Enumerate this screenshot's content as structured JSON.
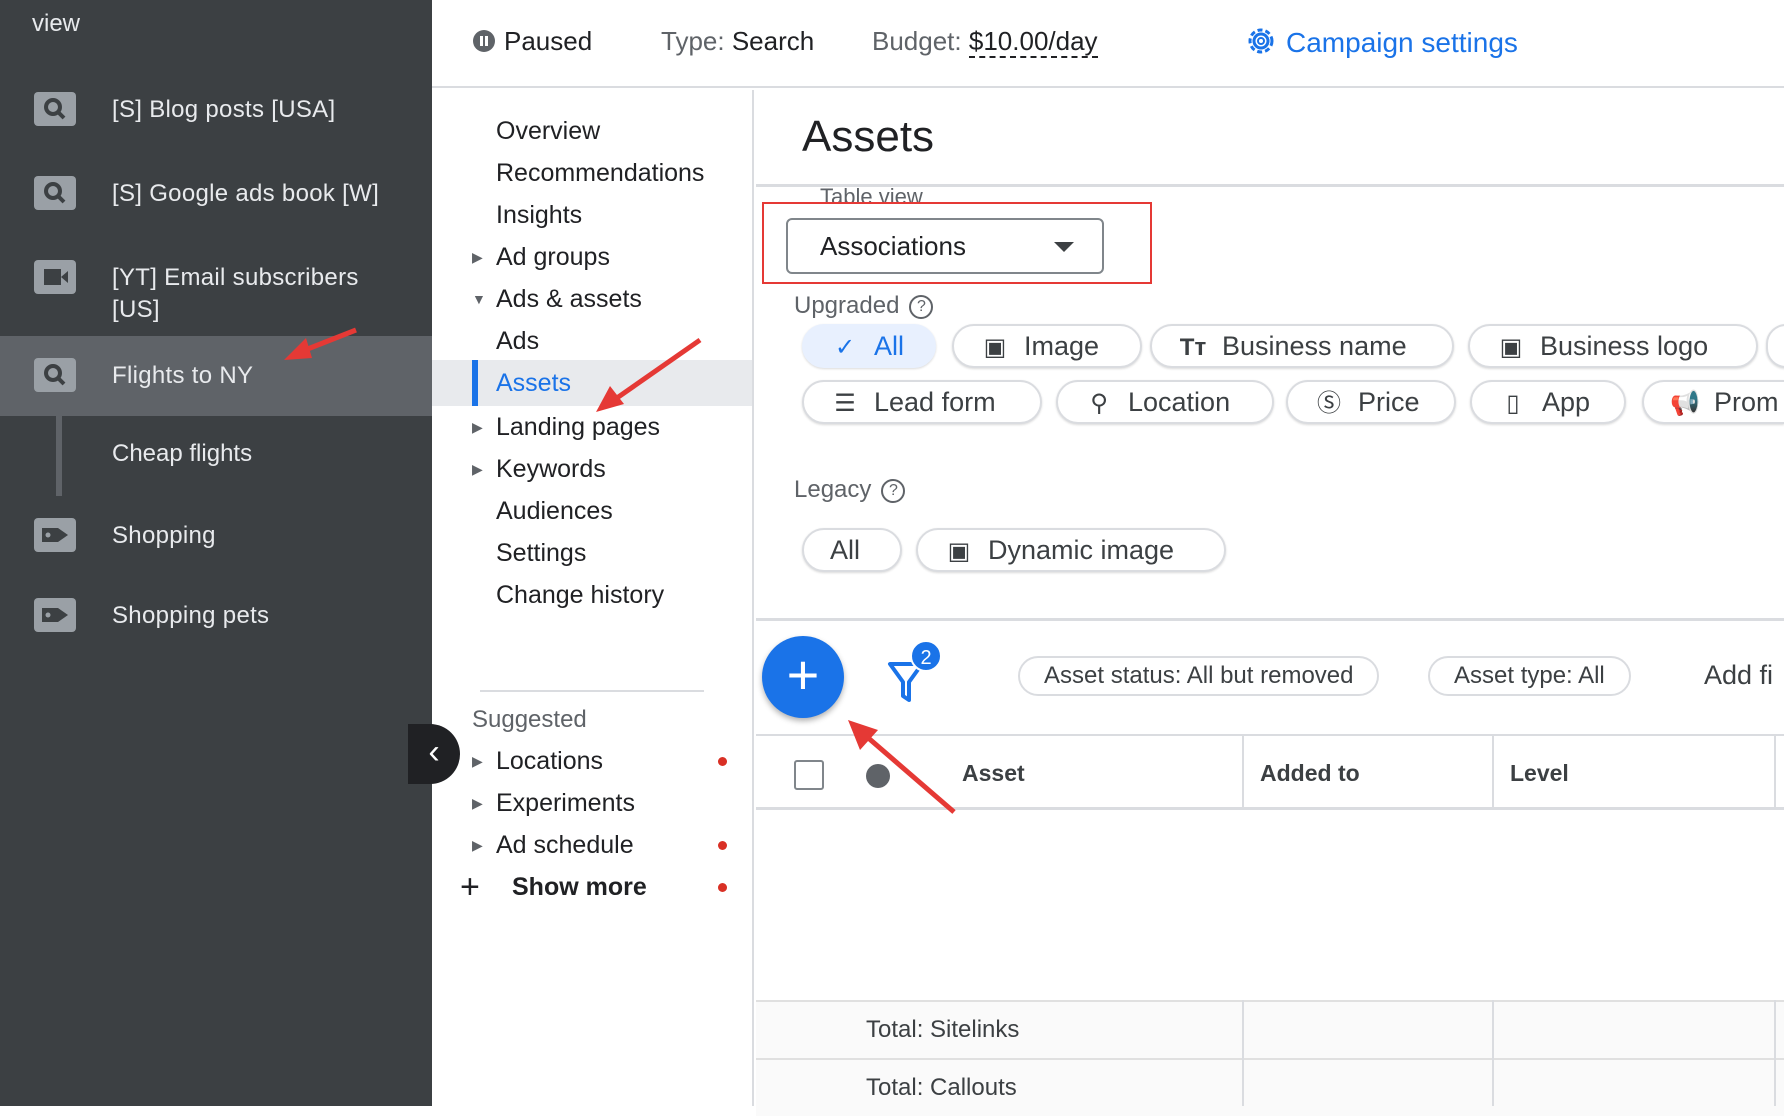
{
  "left_panel": {
    "top_text": "view",
    "campaigns": [
      {
        "label": "[S] Blog posts [USA]",
        "icon": "search-icon"
      },
      {
        "label": "[S] Google ads book [W]",
        "icon": "search-icon"
      },
      {
        "label": "[YT] Email subscribers [US]",
        "icon": "video-icon"
      },
      {
        "label": "Flights to NY",
        "icon": "search-icon",
        "selected": true
      },
      {
        "label": "Shopping",
        "icon": "tag-icon"
      },
      {
        "label": "Shopping pets",
        "icon": "tag-icon"
      }
    ],
    "ad_group": "Cheap flights"
  },
  "header": {
    "status": "Paused",
    "type_label": "Type:",
    "type_value": "Search",
    "budget_label": "Budget:",
    "budget_value": "$10.00/day",
    "settings_link": "Campaign settings"
  },
  "nav": {
    "items": [
      {
        "label": "Overview"
      },
      {
        "label": "Recommendations"
      },
      {
        "label": "Insights"
      },
      {
        "label": "Ad groups",
        "caret": "right"
      },
      {
        "label": "Ads & assets",
        "caret": "down"
      },
      {
        "label": "Ads"
      },
      {
        "label": "Assets",
        "active": true
      },
      {
        "label": "Landing pages",
        "caret": "right"
      },
      {
        "label": "Keywords",
        "caret": "right"
      },
      {
        "label": "Audiences"
      },
      {
        "label": "Settings"
      },
      {
        "label": "Change history"
      }
    ],
    "suggested_label": "Suggested",
    "suggested": [
      {
        "label": "Locations",
        "dot": true
      },
      {
        "label": "Experiments",
        "dot": false
      },
      {
        "label": "Ad schedule",
        "dot": true
      }
    ],
    "show_more": "Show more"
  },
  "main": {
    "title": "Assets",
    "table_view_label": "Table view",
    "table_view_value": "Associations",
    "upgraded_label": "Upgraded",
    "upgraded_chips": [
      {
        "label": "All",
        "icon": "check-icon",
        "selected": true
      },
      {
        "label": "Image",
        "icon": "image-icon"
      },
      {
        "label": "Business name",
        "icon": "text-icon"
      },
      {
        "label": "Business logo",
        "icon": "image-icon"
      },
      {
        "label": "Lead form",
        "icon": "form-icon"
      },
      {
        "label": "Location",
        "icon": "location-pin-icon"
      },
      {
        "label": "Price",
        "icon": "price-icon"
      },
      {
        "label": "App",
        "icon": "phone-icon"
      },
      {
        "label": "Prom",
        "icon": "megaphone-icon"
      }
    ],
    "legacy_label": "Legacy",
    "legacy_chips": [
      {
        "label": "All"
      },
      {
        "label": "Dynamic image",
        "icon": "image-icon"
      }
    ],
    "filter_count": "2",
    "filters": [
      "Asset status: All but removed",
      "Asset type: All"
    ],
    "add_filter": "Add fi",
    "table": {
      "columns": [
        "Asset",
        "Added to",
        "Level"
      ],
      "totals": [
        "Total: Sitelinks",
        "Total: Callouts"
      ]
    }
  },
  "colors": {
    "accent": "#1a73e8",
    "sidebar_bg": "#3c4043",
    "annotation": "#e53935"
  }
}
